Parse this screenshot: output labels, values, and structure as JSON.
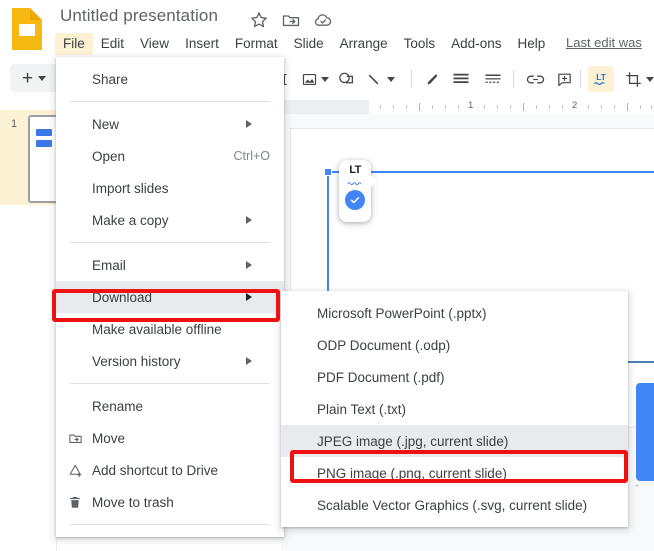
{
  "app": {
    "name": "Google Slides",
    "logo_icon": "slides-logo-icon"
  },
  "titlebar": {
    "document_title": "Untitled presentation",
    "icons": [
      {
        "name": "star-icon",
        "label": "Star"
      },
      {
        "name": "move-to-folder-icon",
        "label": "Move to folder"
      },
      {
        "name": "cloud-saved-icon",
        "label": "Saved to Drive"
      }
    ],
    "last_edit_text": "Last edit was"
  },
  "menubar": {
    "items": [
      {
        "label": "File",
        "active": true
      },
      {
        "label": "Edit",
        "active": false
      },
      {
        "label": "View",
        "active": false
      },
      {
        "label": "Insert",
        "active": false
      },
      {
        "label": "Format",
        "active": false
      },
      {
        "label": "Slide",
        "active": false
      },
      {
        "label": "Arrange",
        "active": false
      },
      {
        "label": "Tools",
        "active": false
      },
      {
        "label": "Add-ons",
        "active": false
      },
      {
        "label": "Help",
        "active": false
      }
    ]
  },
  "toolbar": {
    "new_slide_label": "+",
    "items": [
      {
        "name": "text-box-icon",
        "label": "Text box"
      },
      {
        "name": "insert-image-icon",
        "label": "Insert image"
      },
      {
        "name": "shape-icon",
        "label": "Shape"
      },
      {
        "name": "line-icon",
        "label": "Line"
      },
      {
        "name": "pen-icon",
        "label": "Pen / highlight"
      },
      {
        "name": "align-icon",
        "label": "Align"
      },
      {
        "name": "line-spacing-icon",
        "label": "Line spacing"
      },
      {
        "name": "insert-link-icon",
        "label": "Insert link"
      },
      {
        "name": "comment-icon",
        "label": "Add comment"
      },
      {
        "name": "language-tool-icon",
        "label": "LanguageTool"
      },
      {
        "name": "crop-icon",
        "label": "Crop image"
      }
    ]
  },
  "filmstrip": {
    "slides": [
      {
        "number": "1"
      }
    ]
  },
  "ruler": {
    "unit_labels": [
      "1",
      "2"
    ]
  },
  "file_menu": {
    "groups": [
      {
        "items": [
          {
            "label": "Share",
            "icon": null,
            "shortcut": null,
            "submenu": false,
            "highlighted": false
          }
        ]
      },
      {
        "items": [
          {
            "label": "New",
            "icon": null,
            "shortcut": null,
            "submenu": true,
            "highlighted": false
          },
          {
            "label": "Open",
            "icon": null,
            "shortcut": "Ctrl+O",
            "submenu": false,
            "highlighted": false
          },
          {
            "label": "Import slides",
            "icon": null,
            "shortcut": null,
            "submenu": false,
            "highlighted": false
          },
          {
            "label": "Make a copy",
            "icon": null,
            "shortcut": null,
            "submenu": true,
            "highlighted": false
          }
        ]
      },
      {
        "items": [
          {
            "label": "Email",
            "icon": null,
            "shortcut": null,
            "submenu": true,
            "highlighted": false
          },
          {
            "label": "Download",
            "icon": null,
            "shortcut": null,
            "submenu": true,
            "highlighted": true
          },
          {
            "label": "Make available offline",
            "icon": null,
            "shortcut": null,
            "submenu": false,
            "highlighted": false
          },
          {
            "label": "Version history",
            "icon": null,
            "shortcut": null,
            "submenu": true,
            "highlighted": false
          }
        ]
      },
      {
        "items": [
          {
            "label": "Rename",
            "icon": null,
            "shortcut": null,
            "submenu": false,
            "highlighted": false
          },
          {
            "label": "Move",
            "icon": "move-folder-icon",
            "shortcut": null,
            "submenu": false,
            "highlighted": false
          },
          {
            "label": "Add shortcut to Drive",
            "icon": "add-shortcut-icon",
            "shortcut": null,
            "submenu": false,
            "highlighted": false
          },
          {
            "label": "Move to trash",
            "icon": "trash-icon",
            "shortcut": null,
            "submenu": false,
            "highlighted": false
          }
        ]
      }
    ]
  },
  "download_submenu": {
    "items": [
      {
        "label": "Microsoft PowerPoint (.pptx)",
        "highlighted": false
      },
      {
        "label": "ODP Document (.odp)",
        "highlighted": false
      },
      {
        "label": "PDF Document (.pdf)",
        "highlighted": false
      },
      {
        "label": "Plain Text (.txt)",
        "highlighted": false
      },
      {
        "label": "JPEG image (.jpg, current slide)",
        "highlighted": true
      },
      {
        "label": "PNG image (.png, current slide)",
        "highlighted": false
      },
      {
        "label": "Scalable Vector Graphics (.svg, current slide)",
        "highlighted": false
      }
    ]
  },
  "annotations": [
    {
      "name": "redbox-download",
      "target": "Download",
      "color": "#ee1111"
    },
    {
      "name": "redbox-jpeg",
      "target": "JPEG image (.jpg, current slide)",
      "color": "#ee1111"
    }
  ],
  "colors": {
    "accent_blue": "#4285f4",
    "slides_yellow": "#f5b912",
    "menu_highlight": "#e8eaed",
    "annotation_red": "#ee1111",
    "text_primary": "#3c4043",
    "text_secondary": "#5f6368"
  }
}
